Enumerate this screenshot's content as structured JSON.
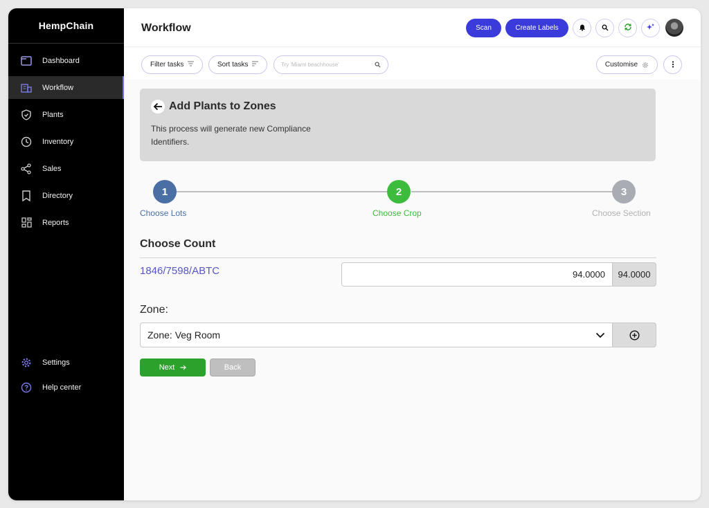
{
  "brand": "HempChain",
  "sidebar": {
    "items": [
      {
        "label": "Dashboard",
        "icon": "dashboard-icon"
      },
      {
        "label": "Workflow",
        "icon": "workflow-icon",
        "active": true
      },
      {
        "label": "Plants",
        "icon": "shield-icon"
      },
      {
        "label": "Inventory",
        "icon": "clock-icon"
      },
      {
        "label": "Sales",
        "icon": "share-icon"
      },
      {
        "label": "Directory",
        "icon": "bookmark-icon"
      },
      {
        "label": "Reports",
        "icon": "grid-icon"
      }
    ],
    "bottom": [
      {
        "label": "Settings",
        "icon": "gear-icon"
      },
      {
        "label": "Help center",
        "icon": "help-icon"
      }
    ]
  },
  "header": {
    "title": "Workflow",
    "scan_label": "Scan",
    "create_labels_label": "Create Labels"
  },
  "toolbar": {
    "filter_label": "Filter tasks",
    "sort_label": "Sort tasks",
    "search_placeholder": "Try 'Miami beachhouse'",
    "customise_label": "Customise"
  },
  "banner": {
    "title": "Add Plants to Zones",
    "description": "This process will generate new Compliance Identifiers."
  },
  "stepper": {
    "steps": [
      {
        "number": "1",
        "label": "Choose Lots",
        "state": "done"
      },
      {
        "number": "2",
        "label": "Choose Crop",
        "state": "current"
      },
      {
        "number": "3",
        "label": "Choose Section",
        "state": "pending"
      }
    ]
  },
  "count": {
    "title": "Choose Count",
    "lot_code": "1846/7598/ABTC",
    "value": "94.0000",
    "max": "94.0000"
  },
  "zone": {
    "label": "Zone:",
    "selected": "Zone: Veg Room"
  },
  "actions": {
    "next_label": "Next",
    "back_label": "Back"
  },
  "colors": {
    "primary": "#3b3bdc",
    "step_done": "#4a6fa5",
    "step_current": "#3dbb3d",
    "step_pending": "#a9acb2",
    "next_button": "#2ca12c",
    "lot_code": "#5656c6"
  }
}
